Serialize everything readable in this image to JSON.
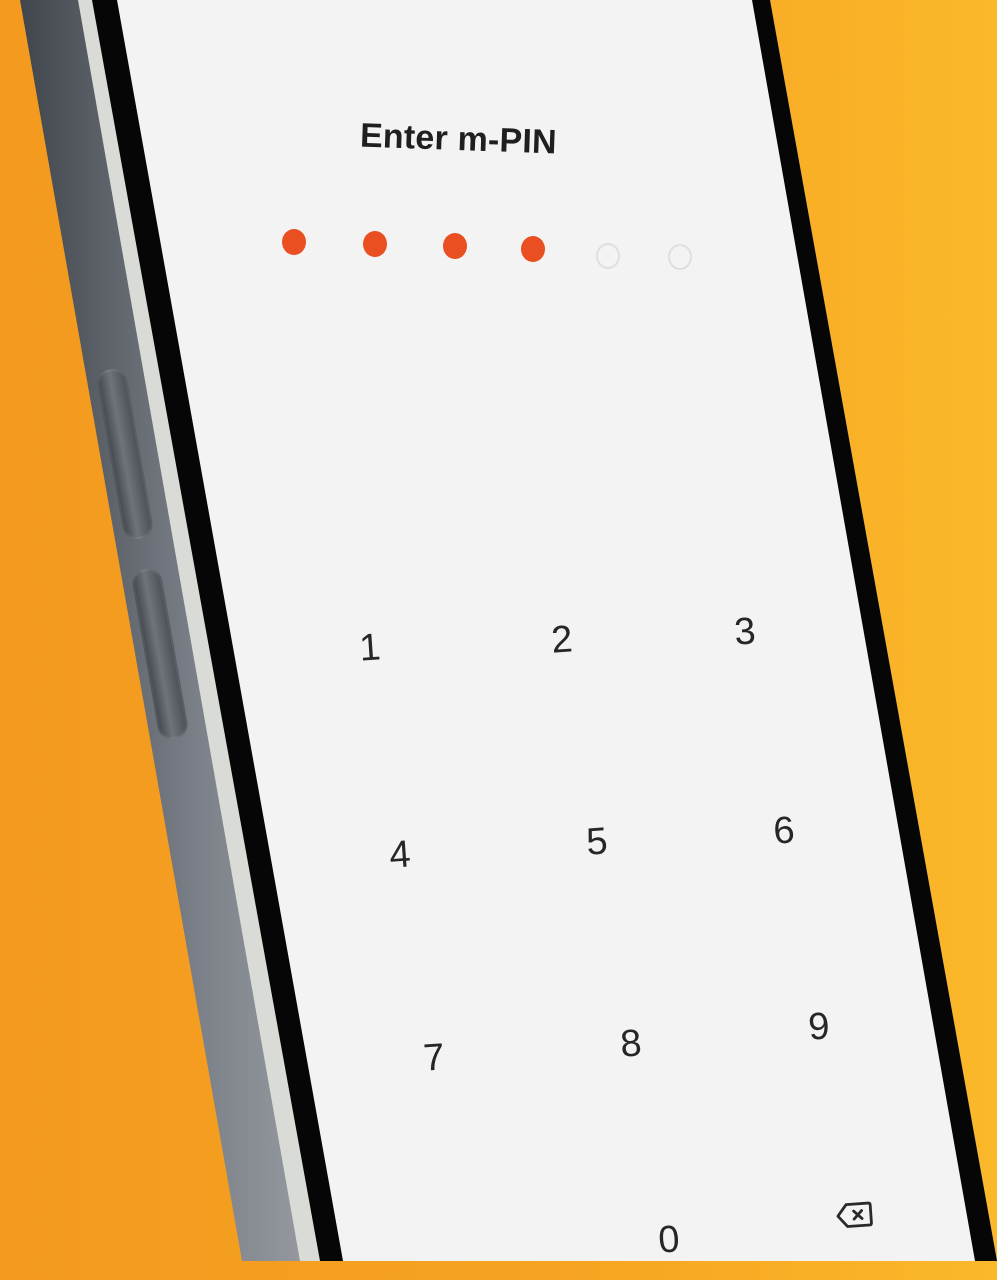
{
  "screen": {
    "title": "Enter m-PIN"
  },
  "pin": {
    "length": 6,
    "filled": 4
  },
  "keypad": {
    "keys": [
      "1",
      "2",
      "3",
      "4",
      "5",
      "6",
      "7",
      "8",
      "9",
      "0"
    ],
    "backspace_icon": "backspace-icon"
  },
  "colors": {
    "background": "#f6a321",
    "screen": "#f3f3f3",
    "accent": "#ea4f22",
    "text": "#262626"
  }
}
